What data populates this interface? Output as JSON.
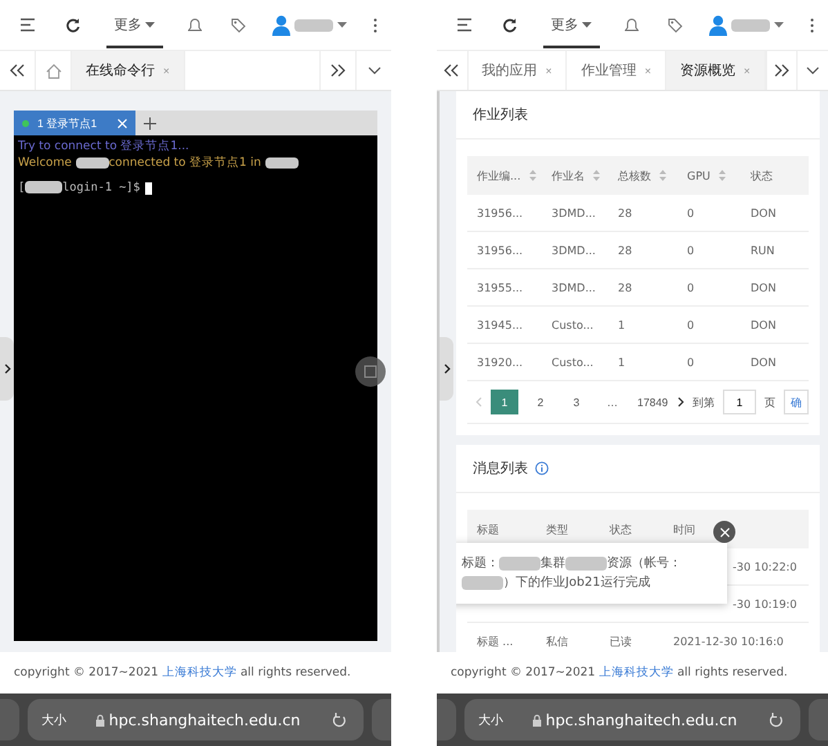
{
  "left_screen": {
    "toolbar": {
      "more": "更多"
    },
    "tabs": [
      {
        "label": "在线命令行",
        "selected": true,
        "close": "×"
      }
    ],
    "terminal": {
      "tabs": [
        {
          "label": "1 登录节点1",
          "selected": true,
          "connected": true
        }
      ],
      "lines": [
        {
          "kind": "info",
          "segments": [
            {
              "kind": "text",
              "text": "Try to connect to 登录节点1..."
            }
          ]
        },
        {
          "kind": "welcome",
          "segments": [
            {
              "kind": "text",
              "text": "Welcome "
            },
            {
              "kind": "redacted"
            },
            {
              "kind": "text",
              "text": "connected to 登录节点1 in "
            },
            {
              "kind": "redacted"
            }
          ]
        },
        {
          "kind": "prompt",
          "segments": [
            {
              "kind": "text",
              "text": "["
            },
            {
              "kind": "redacted"
            },
            {
              "kind": "text",
              "text": "login-1 ~]$"
            }
          ]
        }
      ]
    },
    "footer": {
      "prefix": "copyright © 2017~2021 ",
      "link": "上海科技大学",
      "suffix": " all rights reserved."
    },
    "browser": {
      "text_size": "大小",
      "url": "hpc.shanghaitech.edu.cn"
    }
  },
  "right_screen": {
    "toolbar": {
      "more": "更多"
    },
    "tabs": [
      {
        "label": "我的应用",
        "selected": false,
        "close": "×"
      },
      {
        "label": "作业管理",
        "selected": false,
        "close": "×"
      },
      {
        "label": "资源概览",
        "selected": true,
        "close": "×"
      }
    ],
    "jobs": {
      "title": "作业列表",
      "columns": [
        {
          "label": "作业编...",
          "sortable": true
        },
        {
          "label": "作业名",
          "sortable": true
        },
        {
          "label": "总核数",
          "sortable": true
        },
        {
          "label": "GPU",
          "sortable": true
        },
        {
          "label": "状态",
          "sortable": false
        }
      ],
      "rows": [
        [
          "31956...",
          "3DMD...",
          "28",
          "0",
          "DON"
        ],
        [
          "31956...",
          "3DMD...",
          "28",
          "0",
          "RUN"
        ],
        [
          "31955...",
          "3DMD...",
          "28",
          "0",
          "DON"
        ],
        [
          "31945...",
          "Custo...",
          "1",
          "0",
          "DON"
        ],
        [
          "31920...",
          "Custo...",
          "1",
          "0",
          "DON"
        ]
      ],
      "pagination": {
        "pages": [
          {
            "label": "1",
            "selected": true
          },
          {
            "label": "2",
            "selected": false
          },
          {
            "label": "3",
            "selected": false
          },
          {
            "label": "…",
            "selected": false
          },
          {
            "label": "17849",
            "selected": false
          }
        ],
        "goto_label": "到第",
        "goto_value": "1",
        "page_suffix": "页",
        "confirm": "确"
      }
    },
    "messages": {
      "title": "消息列表",
      "columns": [
        "标题",
        "类型",
        "状态",
        "时间"
      ],
      "rows": [
        {
          "time": "-30 10:22:0"
        },
        {
          "time": "-30 10:19:0"
        },
        {
          "title": "标题 ...",
          "type": "私信",
          "status": "已读",
          "time": "2021-12-30 10:16:0"
        }
      ],
      "popup": {
        "segments": [
          {
            "kind": "text",
            "text": "标题："
          },
          {
            "kind": "redacted"
          },
          {
            "kind": "text",
            "text": "集群"
          },
          {
            "kind": "redacted"
          },
          {
            "kind": "text",
            "text": "资源（帐号："
          },
          {
            "kind": "redacted"
          },
          {
            "kind": "text",
            "text": "）下的作业Job21运行完成"
          }
        ]
      }
    },
    "footer": {
      "prefix": "copyright © 2017~2021 ",
      "link": "上海科技大学",
      "suffix": " all rights reserved."
    },
    "browser": {
      "text_size": "大小",
      "url": "hpc.shanghaitech.edu.cn"
    }
  }
}
